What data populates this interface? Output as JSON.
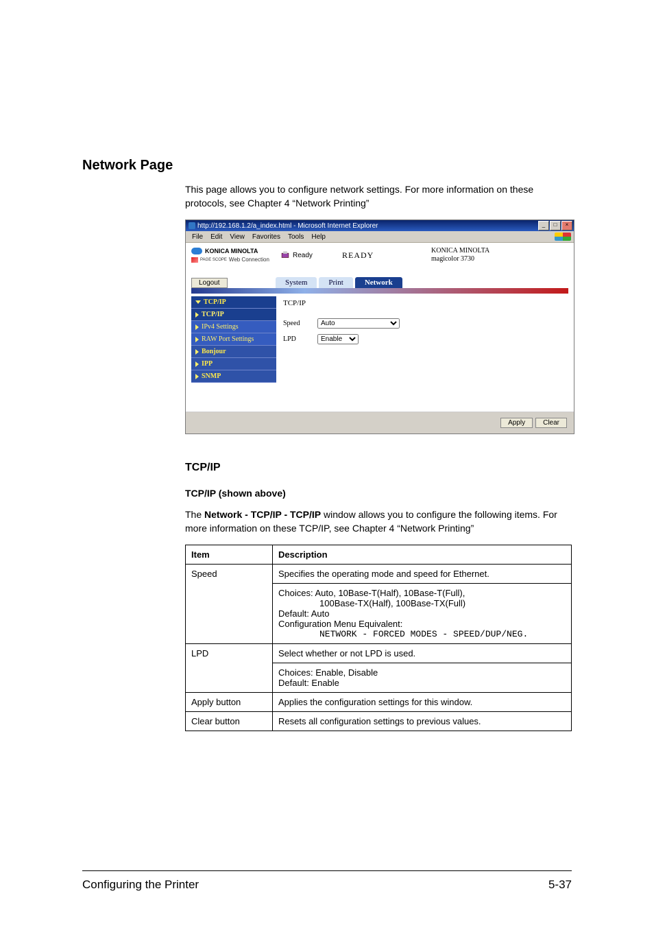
{
  "main": {
    "heading": "Network Page",
    "intro": "This page allows you to configure network settings. For more information on these protocols, see Chapter 4 “Network Printing”",
    "sub_heading": "TCP/IP",
    "sub_caption": "TCP/IP (shown above)",
    "desc_pre": "The ",
    "desc_bold": "Network - TCP/IP - TCP/IP",
    "desc_post": " window allows you to configure the following items. For more information on these TCP/IP, see Chapter 4 “Network Printing”"
  },
  "screenshot": {
    "title": "http://192.168.1.2/a_index.html - Microsoft Internet Explorer",
    "menu": [
      "File",
      "Edit",
      "View",
      "Favorites",
      "Tools",
      "Help"
    ],
    "brand": "KONICA MINOLTA",
    "web_connection": "Web Connection",
    "page_scope": "PAGE SCOPE",
    "status": "Ready",
    "ready": "READY",
    "device_line1": "KONICA MINOLTA",
    "device_line2": "magicolor 3730",
    "logout": "Logout",
    "tabs": {
      "system": "System",
      "print": "Print",
      "network": "Network"
    },
    "sidebar": {
      "tcpip_group": "TCP/IP",
      "tcpip": "TCP/IP",
      "ipv4": "IPv4 Settings",
      "raw": "RAW Port Settings",
      "bonjour": "Bonjour",
      "ipp": "IPP",
      "snmp": "SNMP"
    },
    "pane": {
      "title": "TCP/IP",
      "speed_label": "Speed",
      "speed_value": "Auto",
      "lpd_label": "LPD",
      "lpd_value": "Enable"
    },
    "buttons": {
      "apply": "Apply",
      "clear": "Clear"
    }
  },
  "table": {
    "h_item": "Item",
    "h_desc": "Description",
    "r1_item": "Speed",
    "r1_l1": "Specifies the operating mode and speed for Ethernet.",
    "r1_l2a": "Choices: Auto, 10Base-T(Half), 10Base-T(Full),",
    "r1_l2b": "100Base-TX(Half), 100Base-TX(Full)",
    "r1_l3": "Default:  Auto",
    "r1_l4": "Configuration Menu Equivalent:",
    "r1_l5": "NETWORK - FORCED MODES - SPEED/DUP/NEG.",
    "r2_item": "LPD",
    "r2_l1": "Select whether or not LPD is used.",
    "r2_l2": "Choices: Enable, Disable",
    "r2_l3": "Default:  Enable",
    "r3_item": "Apply button",
    "r3_desc": "Applies the configuration settings for this window.",
    "r4_item": "Clear button",
    "r4_desc": "Resets all configuration settings to previous values."
  },
  "footer": {
    "left": "Configuring the Printer",
    "right": "5-37"
  },
  "chart_data": {
    "type": "table",
    "columns": [
      "Item",
      "Description"
    ],
    "rows": [
      {
        "Item": "Speed",
        "Description": "Specifies the operating mode and speed for Ethernet. Choices: Auto, 10Base-T(Half), 10Base-T(Full), 100Base-TX(Half), 100Base-TX(Full). Default: Auto. Configuration Menu Equivalent: NETWORK - FORCED MODES - SPEED/DUP/NEG."
      },
      {
        "Item": "LPD",
        "Description": "Select whether or not LPD is used. Choices: Enable, Disable. Default: Enable"
      },
      {
        "Item": "Apply button",
        "Description": "Applies the configuration settings for this window."
      },
      {
        "Item": "Clear button",
        "Description": "Resets all configuration settings to previous values."
      }
    ]
  }
}
